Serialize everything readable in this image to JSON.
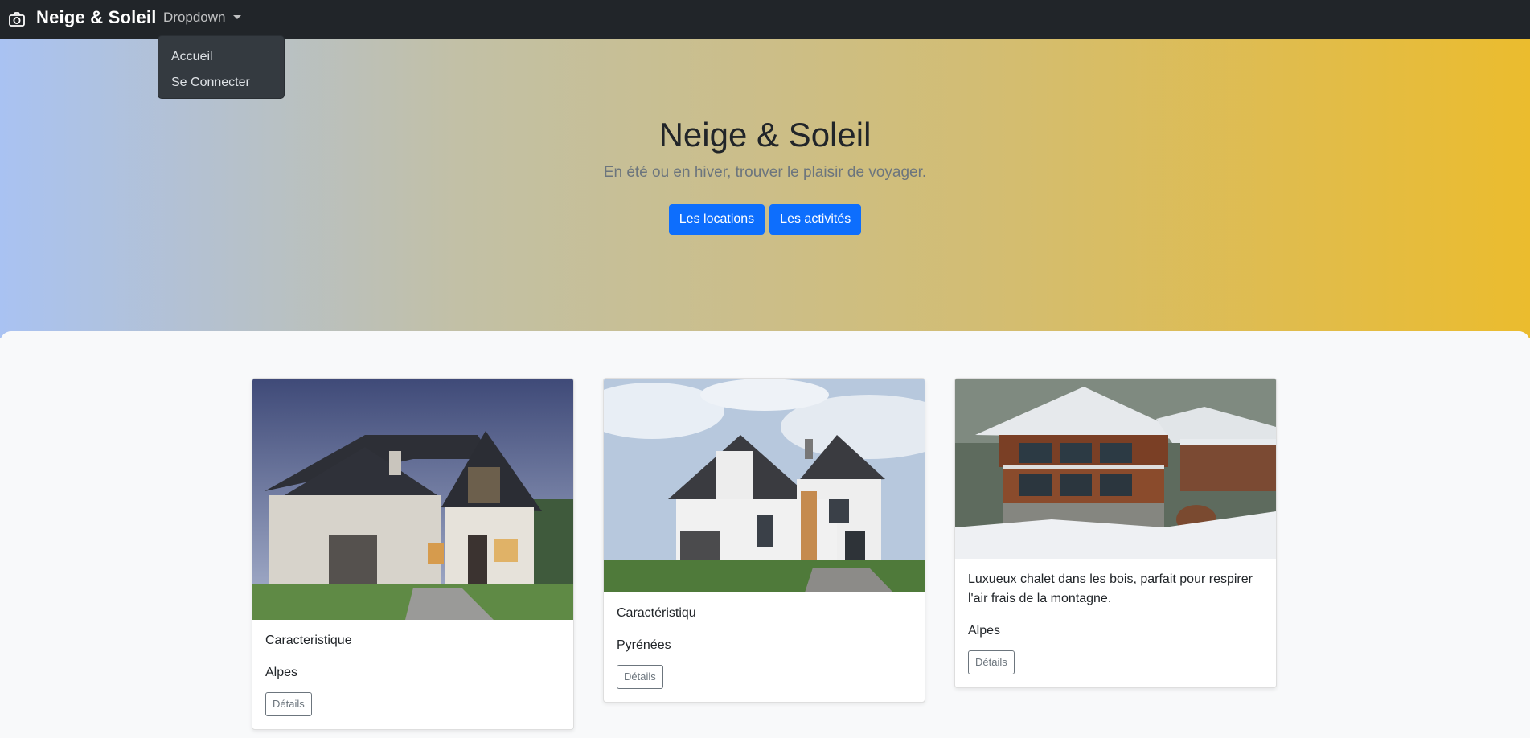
{
  "navbar": {
    "brand": "Neige & Soleil",
    "brand_icon": "camera-icon",
    "dropdown_label": "Dropdown",
    "dropdown_items": [
      "Accueil",
      "Se Connecter"
    ]
  },
  "hero": {
    "title": "Neige & Soleil",
    "subtitle": "En été ou en hiver, trouver le plaisir de voyager.",
    "buttons": [
      "Les locations",
      "Les activités"
    ]
  },
  "cards": [
    {
      "text": "Caracteristique",
      "region": "Alpes",
      "button": "Détails",
      "image": "white-house-photo"
    },
    {
      "text": "Caractéristiqu",
      "region": "Pyrénées",
      "button": "Détails",
      "image": "modern-house-photo"
    },
    {
      "text": "Luxueux chalet dans les bois, parfait pour respirer l'air frais de la montagne.",
      "region": "Alpes",
      "button": "Détails",
      "image": "snow-chalet-photo"
    }
  ],
  "colors": {
    "navbar": "#212529",
    "primary": "#0d6efd",
    "hero_start": "#a9c2f2",
    "hero_end": "#ebbc2e"
  }
}
